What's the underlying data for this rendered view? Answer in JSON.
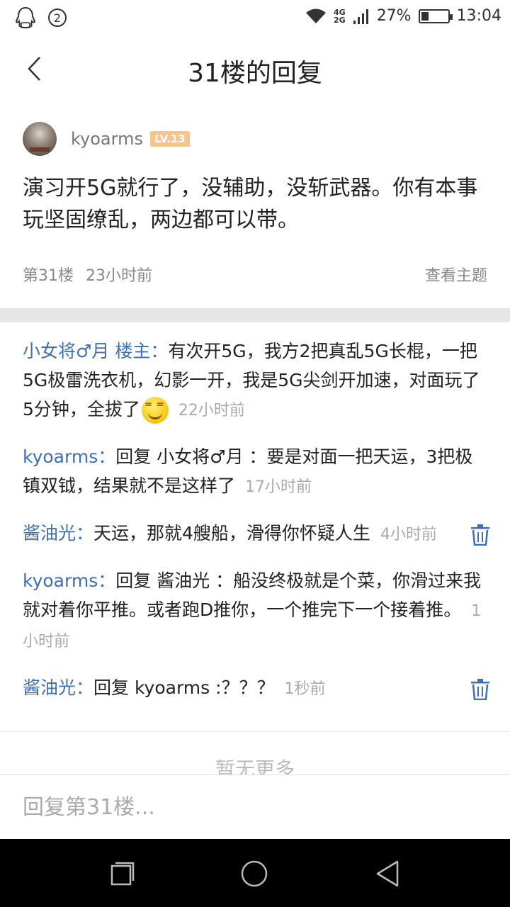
{
  "status_bar": {
    "notification_count": "2",
    "network_label": "4G\n2G",
    "battery_percent": "27%",
    "battery_level": 0.27,
    "time": "13:04",
    "icons": [
      "qq-icon",
      "wifi-icon",
      "signal-icon",
      "battery-icon"
    ]
  },
  "header": {
    "title": "31楼的回复",
    "back_icon": "chevron-left-icon"
  },
  "post": {
    "author": "kyoarms",
    "level": "LV.13",
    "content": "演习开5G就行了，没辅助，没斩武器。你有本事玩坚固缭乱，两边都可以带。",
    "floor": "第31楼",
    "time": "23小时前",
    "view_topic": "查看主题"
  },
  "replies": [
    {
      "who": "小女将♂月 楼主：",
      "text": "有次开5G，我方2把真乱5G长棍，一把5G极雷洗衣机，幻影一开，我是5G尖剑开加速，对面玩了5分钟，全拔了",
      "emoji": "smirk-emoji-icon",
      "time": "22小时前",
      "deletable": false
    },
    {
      "who": "kyoarms：",
      "text": "回复 小女将♂月 ：要是对面一把天运，3把极镇双钺，结果就不是这样了",
      "time": "17小时前",
      "deletable": false
    },
    {
      "who": "酱油光：",
      "text": "天运，那就4艘船，滑得你怀疑人生",
      "time": "4小时前",
      "deletable": true
    },
    {
      "who": "kyoarms：",
      "text": "回复 酱油光 ：船没终极就是个菜，你滑过来我就对着你平推。或者跑D推你，一个推完下一个接着推。",
      "time": "1小时前",
      "deletable": false
    },
    {
      "who": "酱油光：",
      "text": "回复 kyoarms :？？？",
      "time": "1秒前",
      "deletable": true
    }
  ],
  "no_more": "暂无更多",
  "input": {
    "placeholder": "回复第31楼..."
  },
  "nav": {
    "recents_icon": "recents-square-icon",
    "home_icon": "home-circle-icon",
    "back_icon": "back-triangle-icon"
  },
  "colors": {
    "accent": "#3d6fb6",
    "badge": "#f7c58c",
    "divider": "#e6e6e6"
  }
}
